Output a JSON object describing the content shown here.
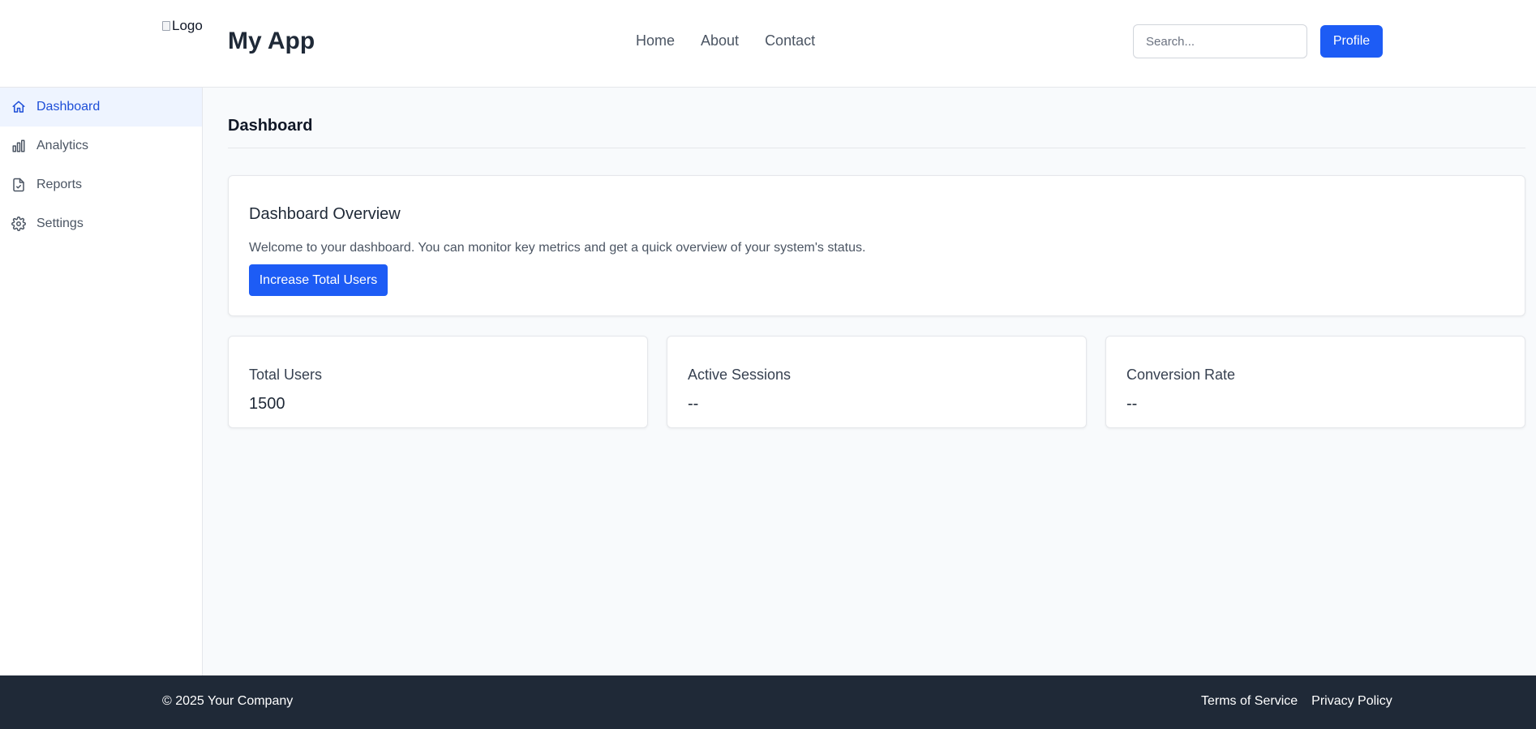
{
  "header": {
    "logo_alt": "Logo",
    "app_title": "My App",
    "nav": [
      {
        "label": "Home"
      },
      {
        "label": "About"
      },
      {
        "label": "Contact"
      }
    ],
    "search_placeholder": "Search...",
    "profile_label": "Profile"
  },
  "sidebar": {
    "items": [
      {
        "label": "Dashboard",
        "icon": "home-icon",
        "active": true
      },
      {
        "label": "Analytics",
        "icon": "bar-chart-icon",
        "active": false
      },
      {
        "label": "Reports",
        "icon": "document-check-icon",
        "active": false
      },
      {
        "label": "Settings",
        "icon": "gear-icon",
        "active": false
      }
    ]
  },
  "main": {
    "page_title": "Dashboard",
    "overview": {
      "title": "Dashboard Overview",
      "description": "Welcome to your dashboard. You can monitor key metrics and get a quick overview of your system's status.",
      "button_label": "Increase Total Users"
    },
    "stats": [
      {
        "label": "Total Users",
        "value": "1500"
      },
      {
        "label": "Active Sessions",
        "value": "--"
      },
      {
        "label": "Conversion Rate",
        "value": "--"
      }
    ]
  },
  "footer": {
    "copyright": "© 2025 Your Company",
    "links": [
      {
        "label": "Terms of Service"
      },
      {
        "label": "Privacy Policy"
      }
    ]
  },
  "colors": {
    "accent": "#1d5cf5",
    "active_bg": "#eef4ff",
    "active_text": "#1d4ed8",
    "footer_bg": "#1f2937",
    "main_bg": "#f8fafc"
  }
}
